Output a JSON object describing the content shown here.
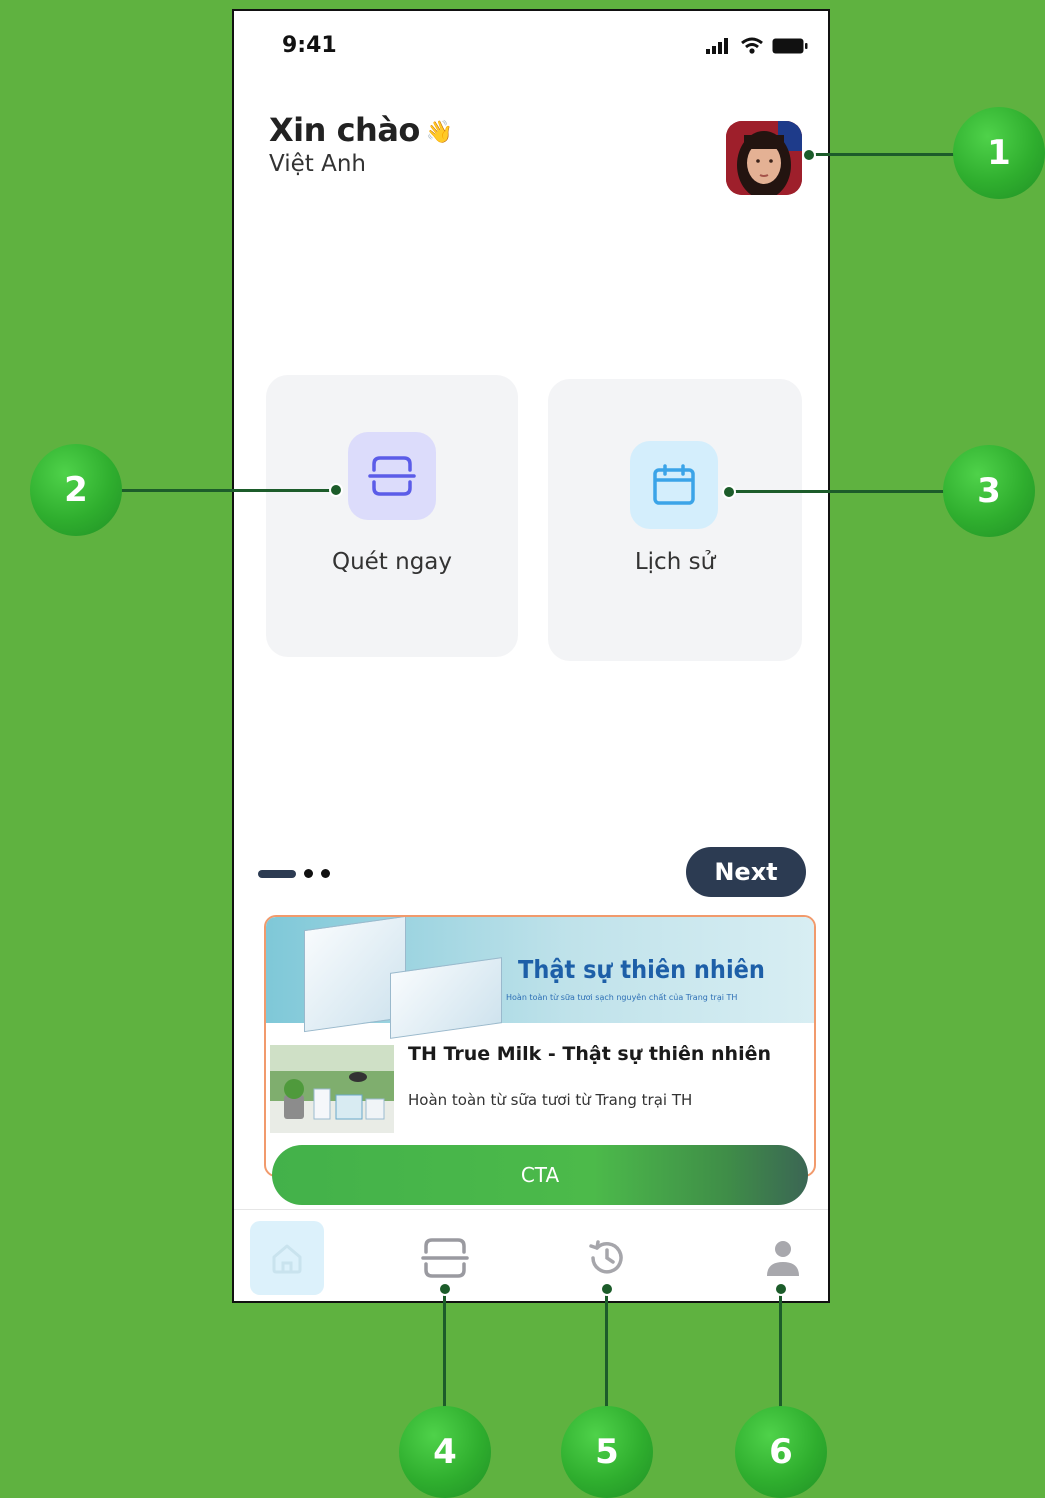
{
  "status_bar": {
    "time": "9:41"
  },
  "header": {
    "greeting": "Xin chào",
    "wave_emoji": "👋",
    "user_name": "Việt Anh"
  },
  "actions": [
    {
      "label": "Quét ngay",
      "icon": "scan-icon",
      "icon_bg": "#dcdcfb",
      "icon_color": "#5b5ce8"
    },
    {
      "label": "Lịch sử",
      "icon": "calendar-icon",
      "icon_bg": "#d4eefc",
      "icon_color": "#3ba4e8"
    }
  ],
  "onboarding": {
    "next_label": "Next"
  },
  "ad": {
    "banner_title": "Thật sự thiên nhiên",
    "banner_subtitle": "Hoàn toàn từ sữa tươi sạch nguyên chất của Trang trại TH",
    "title": "TH True Milk - Thật sự thiên nhiên",
    "description": "Hoàn toàn từ sữa tươi từ Trang trại TH",
    "cta_label": "CTA"
  },
  "bottom_nav": [
    {
      "icon": "home-icon",
      "active": true
    },
    {
      "icon": "scan-icon"
    },
    {
      "icon": "history-icon"
    },
    {
      "icon": "profile-icon"
    }
  ],
  "callouts": [
    "1",
    "2",
    "3",
    "4",
    "5",
    "6"
  ],
  "colors": {
    "background": "#5fb240",
    "callout": "#2fae2e",
    "connector": "#1c5c2a",
    "dark_button": "#2c3b52"
  }
}
